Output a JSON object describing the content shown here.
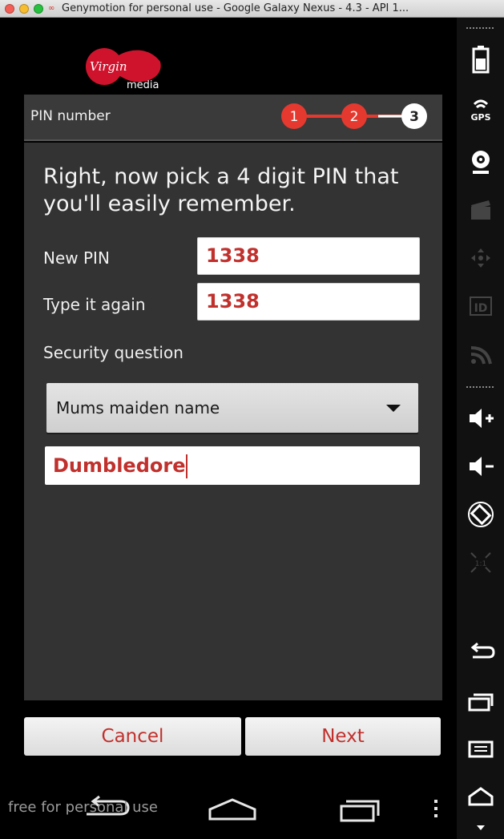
{
  "window": {
    "title": "Genymotion for personal use - Google Galaxy Nexus - 4.3 - API 1..."
  },
  "app": {
    "logo": {
      "brand_text": "Virgin",
      "sub_text": "media"
    },
    "header": {
      "title": "PIN number",
      "steps": [
        "1",
        "2",
        "3"
      ],
      "current_step": 3
    },
    "headline": "Right, now pick a 4 digit PIN that you'll easily remember.",
    "form": {
      "new_pin_label": "New PIN",
      "new_pin_value": "1338",
      "confirm_label": "Type it again",
      "confirm_value": "1338",
      "security_label": "Security question",
      "security_question": "Mums maiden name",
      "security_answer": "Dumbledore"
    },
    "buttons": {
      "cancel": "Cancel",
      "next": "Next"
    }
  },
  "watermark": "free for personal use",
  "sidebar": {
    "icons": [
      "battery-icon",
      "gps-icon",
      "camera-icon",
      "media-icon",
      "dpad-icon",
      "id-icon",
      "rss-icon",
      "volume-up-icon",
      "volume-down-icon",
      "rotate-icon",
      "scale-icon",
      "back-icon",
      "recent-apps-icon",
      "menu-icon",
      "home-icon"
    ],
    "gps_label": "GPS",
    "id_label": "ID",
    "scale_label": "1:1"
  },
  "colors": {
    "accent": "#c0312d",
    "step_done": "#e5392f",
    "background": "#333333"
  }
}
